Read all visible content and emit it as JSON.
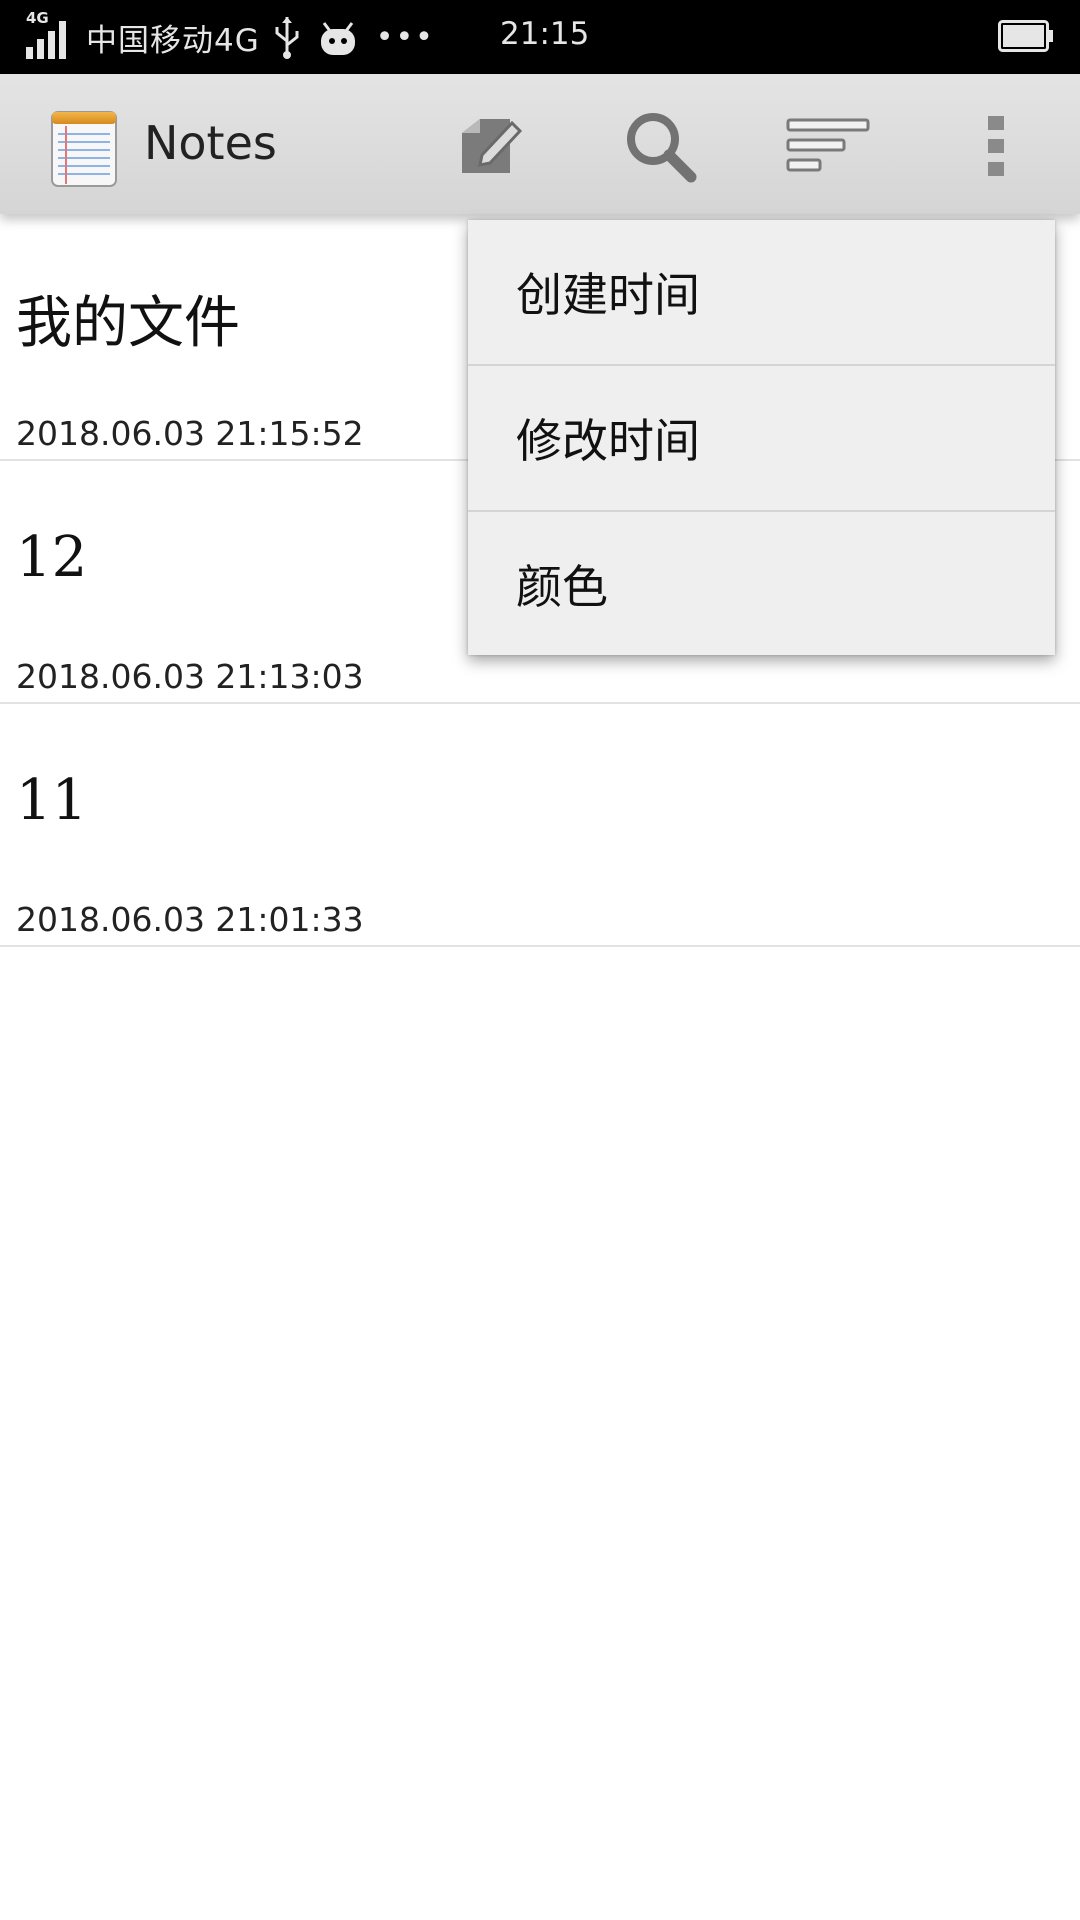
{
  "status_bar": {
    "network_tag": "4G",
    "carrier": "中国移动4G",
    "more": "•••",
    "time": "21:15"
  },
  "action_bar": {
    "title": "Notes",
    "icons": {
      "app": "notepad-icon",
      "compose": "compose-icon",
      "search": "search-icon",
      "sort": "sort-icon",
      "overflow": "overflow-menu-icon"
    }
  },
  "notes": [
    {
      "title": "我的文件",
      "time": "2018.06.03 21:15:52"
    },
    {
      "title": "12",
      "time": "2018.06.03 21:13:03"
    },
    {
      "title": "11",
      "time": "2018.06.03 21:01:33"
    }
  ],
  "sort_menu": {
    "items": [
      {
        "label": "创建时间"
      },
      {
        "label": "修改时间"
      },
      {
        "label": "颜色"
      }
    ]
  }
}
